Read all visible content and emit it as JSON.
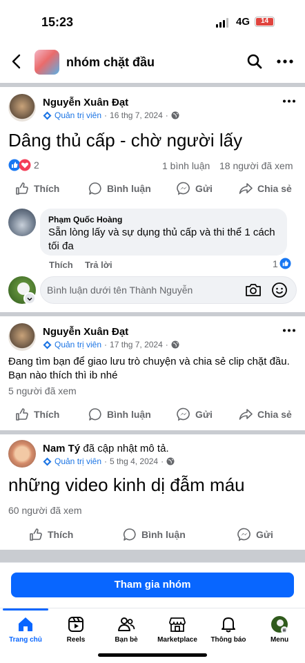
{
  "status": {
    "time": "15:23",
    "network": "4G",
    "battery": "14"
  },
  "header": {
    "group_name": "nhóm chặt đầu"
  },
  "posts": [
    {
      "author": "Nguyễn Xuân Đạt",
      "role": "Quản trị viên",
      "date": "16 thg 7, 2024",
      "title": "Dâng thủ cấp - chờ người lấy",
      "reaction_count": "2",
      "comments": "1 bình luận",
      "views": "18 người đã xem",
      "actions": {
        "like": "Thích",
        "comment": "Bình luận",
        "send": "Gửi",
        "share": "Chia sẻ"
      },
      "top_comment": {
        "author": "Phạm Quốc Hoàng",
        "text": "Sẵn lòng lấy và sự dụng thủ cấp và thi thể 1 cách tối đa",
        "like": "Thích",
        "reply": "Trả lời",
        "likes": "1"
      },
      "comment_placeholder": "Bình luận dưới tên Thành Nguyễn"
    },
    {
      "author": "Nguyễn Xuân Đạt",
      "role": "Quản trị viên",
      "date": "17 thg 7, 2024",
      "text": "Đang tìm bạn để giao lưu trò chuyện và chia sẻ clip chặt đầu. Bạn nào thích thì ib nhé",
      "views": "5 người đã xem",
      "actions": {
        "like": "Thích",
        "comment": "Bình luận",
        "send": "Gửi",
        "share": "Chia sẻ"
      }
    },
    {
      "author": "Nam Tý",
      "author_suffix": "đã cập nhật mô tả.",
      "role": "Quản trị viên",
      "date": "5 thg 4, 2024",
      "title": "những video kinh dị đẫm máu",
      "views": "60 người đã xem",
      "actions": {
        "like": "Thích",
        "comment": "Bình luận",
        "send": "Gửi"
      }
    }
  ],
  "join_button": "Tham gia nhóm",
  "tabs": [
    {
      "label": "Trang chủ",
      "icon": "home-icon",
      "active": true
    },
    {
      "label": "Reels",
      "icon": "reels-icon"
    },
    {
      "label": "Bạn bè",
      "icon": "friends-icon"
    },
    {
      "label": "Marketplace",
      "icon": "marketplace-icon"
    },
    {
      "label": "Thông báo",
      "icon": "bell-icon"
    },
    {
      "label": "Menu",
      "icon": "menu-avatar-icon"
    }
  ],
  "colors": {
    "accent": "#0866ff",
    "admin": "#1b74e4",
    "separator": "#c9ccd1",
    "battery": "#e0443e"
  }
}
